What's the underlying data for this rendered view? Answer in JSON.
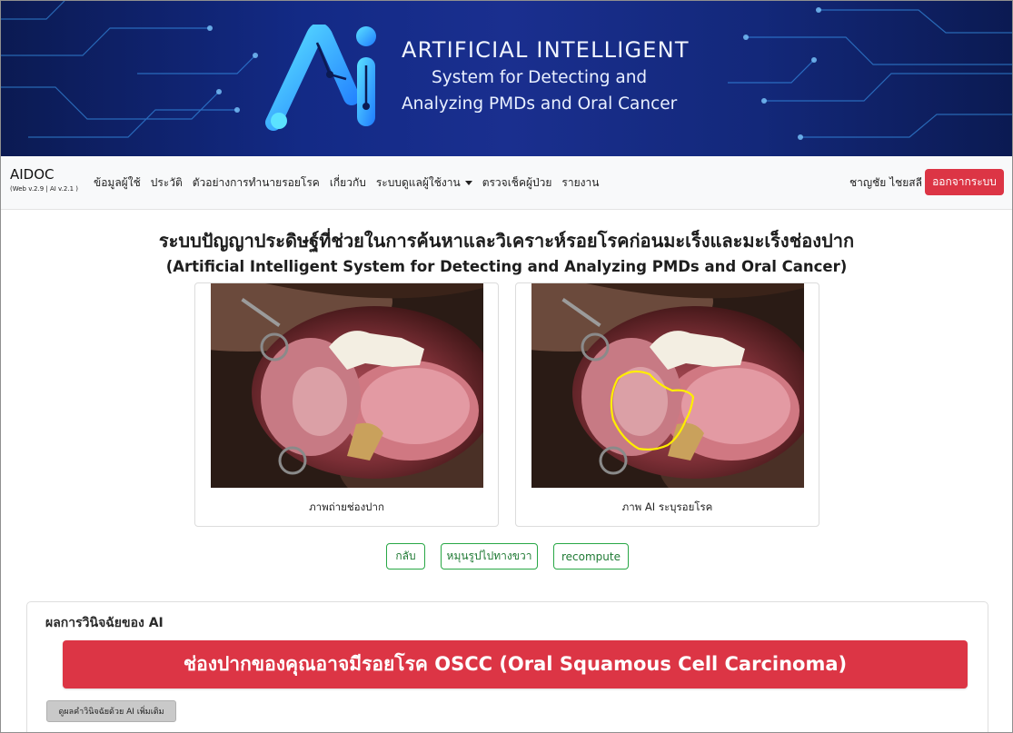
{
  "banner": {
    "title": "ARTIFICIAL INTELLIGENT",
    "subtitle_line1": "System for Detecting and",
    "subtitle_line2": "Analyzing PMDs and Oral Cancer",
    "logo_text": "Ai"
  },
  "navbar": {
    "brand": "AIDOC",
    "version": "(Web v.2.9 | AI v.2.1 )",
    "items": [
      {
        "label": "ข้อมูลผู้ใช้"
      },
      {
        "label": "ประวัติ"
      },
      {
        "label": "ตัวอย่างการทำนายรอยโรค"
      },
      {
        "label": "เกี่ยวกับ"
      },
      {
        "label": "ระบบดูแลผู้ใช้งาน",
        "dropdown": true
      },
      {
        "label": "ตรวจเช็คผู้ป่วย"
      },
      {
        "label": "รายงาน"
      }
    ],
    "user_name": "ชาญชัย ไชยสลี",
    "logout_label": "ออกจากระบบ"
  },
  "main": {
    "title_th": "ระบบปัญญาประดิษฐ์ที่ช่วยในการค้นหาและวิเคราะห์รอยโรคก่อนมะเร็งและมะเร็งช่องปาก",
    "title_en": "(Artificial Intelligent System for Detecting and Analyzing PMDs and Oral Cancer)",
    "images": [
      {
        "caption": "ภาพถ่ายช่องปาก"
      },
      {
        "caption": "ภาพ AI ระบุรอยโรค"
      }
    ],
    "buttons": {
      "back": "กลับ",
      "rotate": "หมุนรูปไปทางขวา",
      "recompute": "recompute"
    }
  },
  "result": {
    "title": "ผลการวินิจฉัยของ AI",
    "diagnosis": "ช่องปากของคุณอาจมีรอยโรค OSCC (Oral Squamous Cell Carcinoma)",
    "more_label": "ดูผลคำวินิจฉัยด้วย AI เพิ่มเติม"
  },
  "colors": {
    "banner_bg": "#13287a",
    "danger": "#dc3545",
    "success_outline": "#28a745",
    "lesion_outline": "#ffee00"
  }
}
